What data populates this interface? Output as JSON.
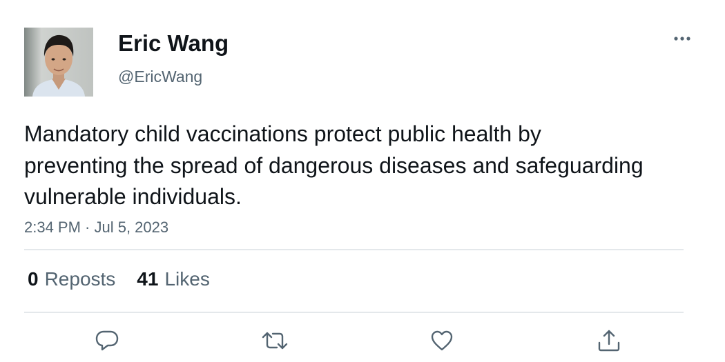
{
  "tweet": {
    "author": {
      "display_name": "Eric Wang",
      "handle": "@EricWang",
      "avatar": "avatar-photo"
    },
    "text": "Mandatory child vaccinations protect public health by preventing the spread of dangerous diseases and safeguarding vulnerable individuals.",
    "timestamp": "2:34 PM · Jul 5, 2023",
    "stats": {
      "reposts_count": "0",
      "reposts_label": "Reposts",
      "likes_count": "41",
      "likes_label": "Likes"
    },
    "actions": [
      {
        "name": "reply",
        "icon": "speech-bubble-icon"
      },
      {
        "name": "repost",
        "icon": "repost-arrows-icon"
      },
      {
        "name": "like",
        "icon": "heart-icon"
      },
      {
        "name": "share",
        "icon": "share-upload-icon"
      }
    ]
  },
  "menu": {
    "icon": "ellipsis-icon"
  },
  "colors": {
    "primary_text": "#0f1419",
    "secondary_text": "#536471",
    "divider": "#e4e8eb"
  }
}
